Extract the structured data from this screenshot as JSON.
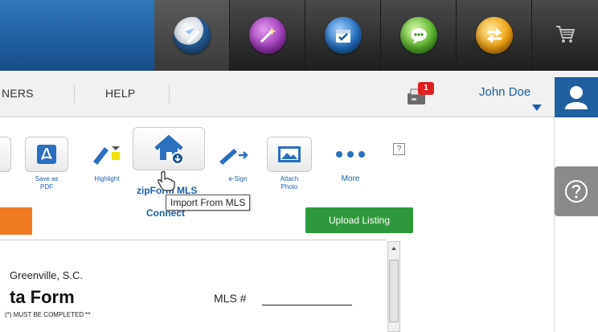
{
  "nav": {
    "partners_label": "NERS",
    "help_label": "HELP",
    "user_name": "John Doe",
    "notification_count": "1"
  },
  "apps": [
    {
      "icon": "zipform-logo-icon",
      "active": true
    },
    {
      "icon": "magic-wand-icon",
      "active": false
    },
    {
      "icon": "calendar-check-icon",
      "active": false
    },
    {
      "icon": "chat-bubble-icon",
      "active": false
    },
    {
      "icon": "transfer-arrows-icon",
      "active": false
    },
    {
      "icon": "cart-icon",
      "active": false
    }
  ],
  "toolbar": {
    "save_pdf": "Save as\nPDF",
    "highlight": "Highlight",
    "import_mls_tooltip": "Import From MLS",
    "esign": "e-Sign",
    "attach_photo": "Attach\nPhoto",
    "more": "More",
    "mls_link": "zipForm MLS",
    "connect": "Connect",
    "help_mark": "?"
  },
  "upload_listing": "Upload Listing",
  "document": {
    "city": "Greenville, S.C.",
    "title": "ta Form",
    "required_note": "(*) MUST BE COMPLETED **",
    "mls_label": "MLS #"
  },
  "colors": {
    "brand_blue": "#1f5f9f",
    "upload_green": "#2e9a3c",
    "accent_orange": "#ee7a23",
    "badge_red": "#e02020"
  }
}
